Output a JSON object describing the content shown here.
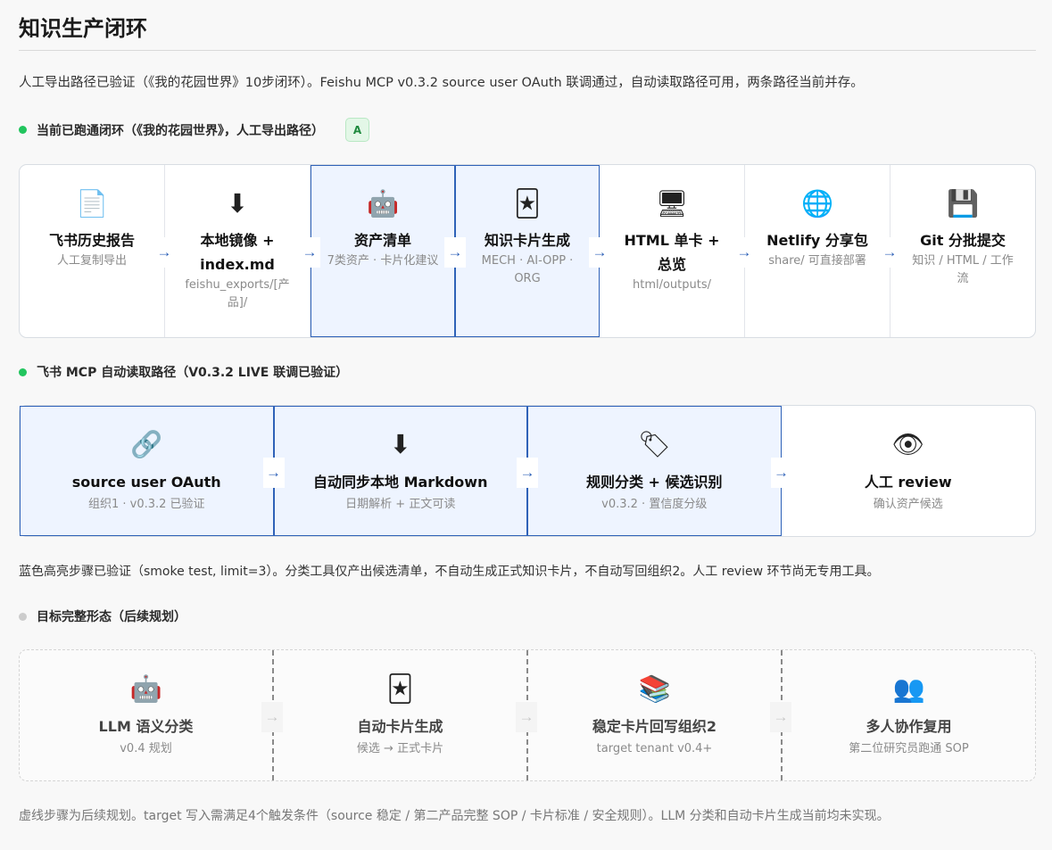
{
  "title": "知识生产闭环",
  "lead": "人工导出路径已验证（《我的花园世界》10步闭环）。Feishu MCP v0.3.2 source user OAuth 联调通过，自动读取路径可用，两条路径当前并存。",
  "colors": {
    "accent": "#2f62b8",
    "live": "#22c55e",
    "planned": "#cccccc",
    "highlight_bg": "#eef4ff"
  },
  "section1": {
    "label": "当前已跑通闭环（《我的花园世界》，人工导出路径）",
    "badge": "A",
    "arrow": "→",
    "steps": [
      {
        "icon": "📄",
        "icon_name": "document-icon",
        "title": "飞书历史报告",
        "sub": "人工复制导出"
      },
      {
        "icon": "⬇",
        "icon_name": "download-icon",
        "title": "本地镜像 + index.md",
        "sub": "feishu_exports/[产品]/"
      },
      {
        "icon": "🤖",
        "icon_name": "robot-icon",
        "title": "资产清单",
        "sub": "7类资产 · 卡片化建议",
        "highlighted": true
      },
      {
        "icon": "🃏",
        "icon_name": "card-icon",
        "title": "知识卡片生成",
        "sub": "MECH · AI-OPP · ORG",
        "highlighted": true
      },
      {
        "icon": "🖥",
        "icon_name": "monitor-icon",
        "title": "HTML 单卡 + 总览",
        "sub": "html/outputs/"
      },
      {
        "icon": "🌐",
        "icon_name": "globe-icon",
        "title": "Netlify 分享包",
        "sub": "share/ 可直接部署"
      },
      {
        "icon": "💾",
        "icon_name": "floppy-disk-icon",
        "title": "Git 分批提交",
        "sub": "知识 / HTML / 工作流"
      }
    ]
  },
  "section2": {
    "label": "飞书 MCP 自动读取路径（V0.3.2 LIVE 联调已验证）",
    "arrow": "→",
    "steps": [
      {
        "icon": "🔗",
        "icon_name": "link-icon",
        "title": "source user OAuth",
        "sub": "组织1 · v0.3.2 已验证",
        "highlighted": true
      },
      {
        "icon": "⬇",
        "icon_name": "download-icon",
        "title": "自动同步本地 Markdown",
        "sub": "日期解析 + 正文可读",
        "highlighted": true
      },
      {
        "icon": "🏷",
        "icon_name": "tag-icon",
        "title": "规则分类 + 候选识别",
        "sub": "v0.3.2 · 置信度分级",
        "highlighted": true
      },
      {
        "icon": "👁",
        "icon_name": "eye-icon",
        "title": "人工 review",
        "sub": "确认资产候选"
      }
    ],
    "note": "蓝色高亮步骤已验证（smoke test, limit=3）。分类工具仅产出候选清单，不自动生成正式知识卡片，不自动写回组织2。人工 review 环节尚无专用工具。"
  },
  "section3": {
    "label": "目标完整形态（后续规划）",
    "arrow": "→",
    "steps": [
      {
        "icon": "🤖",
        "icon_name": "robot-icon",
        "title": "LLM 语义分类",
        "sub": "v0.4 规划"
      },
      {
        "icon": "🃏",
        "icon_name": "card-icon",
        "title": "自动卡片生成",
        "sub": "候选 → 正式卡片"
      },
      {
        "icon": "📚",
        "icon_name": "books-icon",
        "title": "稳定卡片回写组织2",
        "sub": "target tenant v0.4+"
      },
      {
        "icon": "👥",
        "icon_name": "people-icon",
        "title": "多人协作复用",
        "sub": "第二位研究员跑通 SOP"
      }
    ],
    "note": "虚线步骤为后续规划。target 写入需满足4个触发条件（source 稳定 / 第二产品完整 SOP / 卡片标准 / 安全规则）。LLM 分类和自动卡片生成当前均未实现。"
  }
}
